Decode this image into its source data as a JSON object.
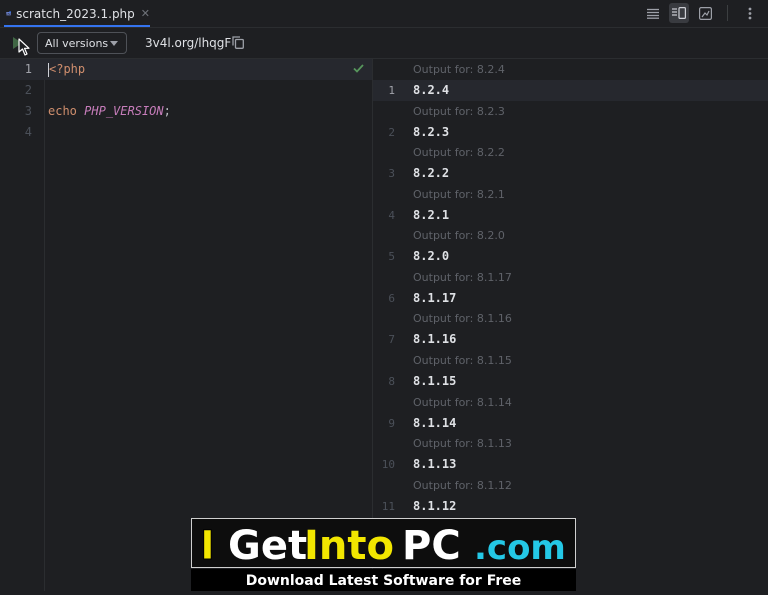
{
  "tab": {
    "label": "scratch_2023.1.php"
  },
  "toolbar": {
    "versions_label": "All versions",
    "link": "3v4l.org/lhqgF"
  },
  "editor": {
    "lines": [
      {
        "num": "1",
        "open_tag": "<?php"
      },
      {
        "num": "2"
      },
      {
        "num": "3",
        "keyword": "echo",
        "constant": "PHP_VERSION",
        "semicolon": ";"
      },
      {
        "num": "4"
      }
    ]
  },
  "output": {
    "blocks": [
      {
        "header": "Output for: 8.2.4",
        "num": "1",
        "value": "8.2.4"
      },
      {
        "header": "Output for: 8.2.3",
        "num": "2",
        "value": "8.2.3"
      },
      {
        "header": "Output for: 8.2.2",
        "num": "3",
        "value": "8.2.2"
      },
      {
        "header": "Output for: 8.2.1",
        "num": "4",
        "value": "8.2.1"
      },
      {
        "header": "Output for: 8.2.0",
        "num": "5",
        "value": "8.2.0"
      },
      {
        "header": "Output for: 8.1.17",
        "num": "6",
        "value": "8.1.17"
      },
      {
        "header": "Output for: 8.1.16",
        "num": "7",
        "value": "8.1.16"
      },
      {
        "header": "Output for: 8.1.15",
        "num": "8",
        "value": "8.1.15"
      },
      {
        "header": "Output for: 8.1.14",
        "num": "9",
        "value": "8.1.14"
      },
      {
        "header": "Output for: 8.1.13",
        "num": "10",
        "value": "8.1.13"
      },
      {
        "header": "Output for: 8.1.12",
        "num": "11",
        "value": "8.1.12"
      }
    ]
  },
  "watermark": {
    "brand_i": "I",
    "brand_get": "Get",
    "brand_into": "Into",
    "brand_pc": "PC",
    "brand_com": ".com",
    "tagline": "Download Latest Software for Free"
  },
  "colors": {
    "accent": "#3574f0",
    "keyword": "#cf8e6d",
    "constant": "#c77dbb",
    "check": "#57965c",
    "brand_yellow": "#f2e600",
    "brand_cyan": "#24c8e6"
  },
  "icons": [
    "php-file-icon",
    "close-icon",
    "menu-lines-icon",
    "split-view-icon",
    "preview-icon",
    "more-vert-icon",
    "run-icon",
    "chevron-down-icon",
    "copy-icon",
    "check-icon"
  ]
}
